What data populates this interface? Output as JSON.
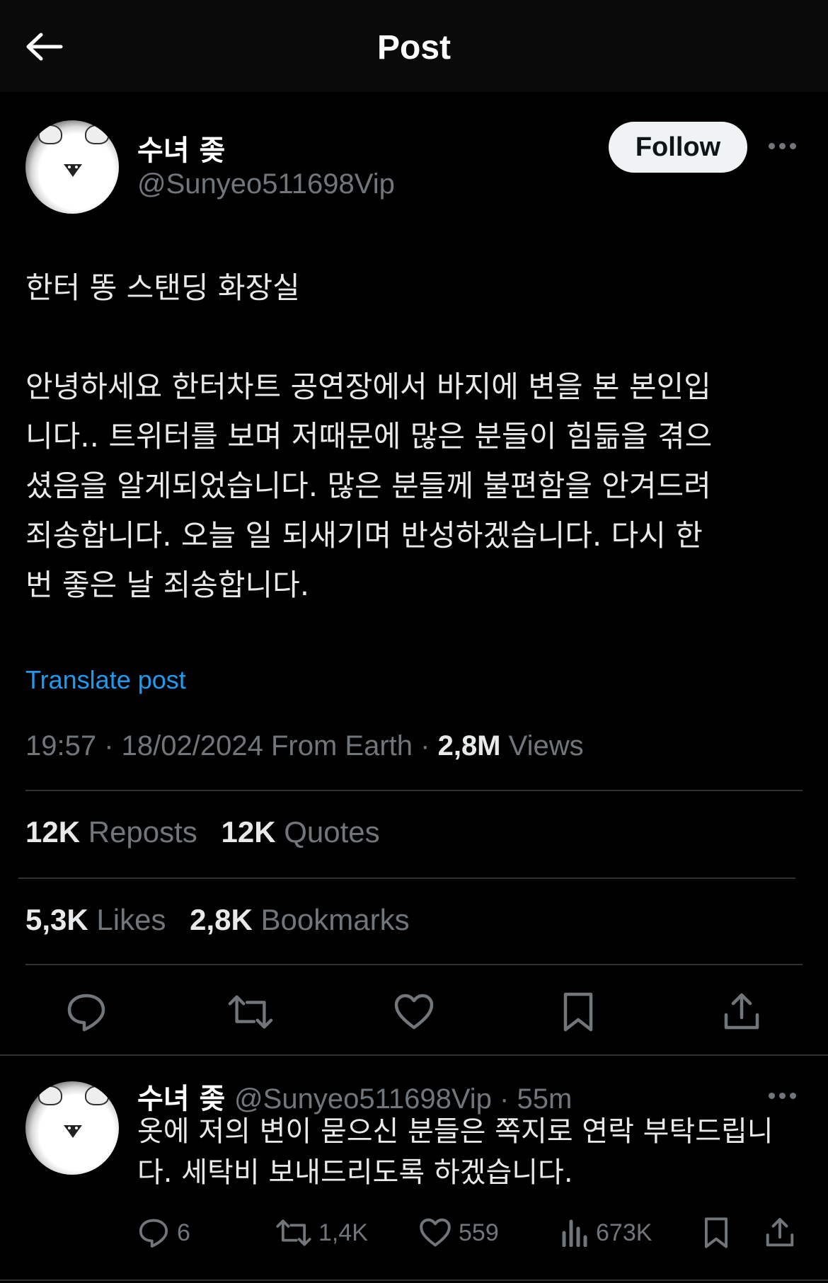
{
  "header": {
    "title": "Post"
  },
  "post": {
    "author_name": "수녀 좆",
    "author_handle": "@Sunyeo511698Vip",
    "follow_label": "Follow",
    "text": "한터 똥 스탠딩 화장실\n\n안녕하세요 한터차트 공연장에서 바지에 변을 본 본인입\n니다.. 트위터를 보며 저때문에 많은 분들이 힘듦을 겪으\n셨음을 알게되었습니다. 많은 분들께 불편함을 안겨드려\n죄송합니다. 오늘 일 되새기며 반성하겠습니다. 다시 한\n번 좋은 날 죄송합니다.",
    "translate_label": "Translate post",
    "time": "19:57",
    "date": "18/02/2024",
    "source": "From Earth",
    "views_count": "2,8M",
    "views_label": "Views",
    "reposts_count": "12K",
    "reposts_label": "Reposts",
    "quotes_count": "12K",
    "quotes_label": "Quotes",
    "likes_count": "5,3K",
    "likes_label": "Likes",
    "bookmarks_count": "2,8K",
    "bookmarks_label": "Bookmarks",
    "icons": [
      "reply-icon",
      "repost-icon",
      "like-icon",
      "bookmark-icon",
      "share-icon"
    ]
  },
  "reply": {
    "author_name": "수녀 좆",
    "author_handle": "@Sunyeo511698Vip",
    "time_ago": "55m",
    "text": "옷에 저의 변이 묻으신 분들은 쪽지로 연락 부탁드립니\n다. 세탁비 보내드리도록 하겠습니다.",
    "replies": "6",
    "reposts": "1,4K",
    "likes": "559",
    "views": "673K"
  },
  "colors": {
    "background": "#000000",
    "link": "#1d9bf0",
    "muted": "#71767b",
    "divider": "#2f3336"
  }
}
